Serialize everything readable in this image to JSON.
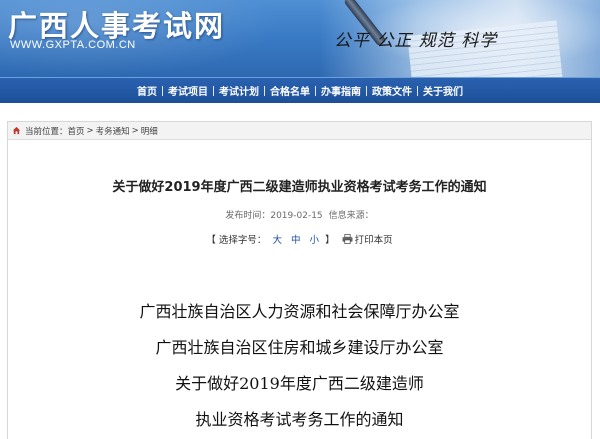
{
  "banner": {
    "site_title": "广西人事考试网",
    "site_url": "WWW.GXPTA.COM.CN",
    "slogan": "公平 公正 规范 科学"
  },
  "nav": {
    "items": [
      {
        "label": "首页"
      },
      {
        "label": "考试项目"
      },
      {
        "label": "考试计划"
      },
      {
        "label": "合格名单"
      },
      {
        "label": "办事指南"
      },
      {
        "label": "政策文件"
      },
      {
        "label": "关于我们"
      }
    ]
  },
  "breadcrumb": {
    "prefix": "当前位置：",
    "items": [
      "首页",
      "考务通知",
      "明细"
    ],
    "separator": ">"
  },
  "article": {
    "title": "关于做好2019年度广西二级建造师执业资格考试考务工作的通知",
    "publish_label": "发布时间：",
    "publish_date": "2019-02-15",
    "source_label": "信息来源：",
    "source_value": "",
    "font_size_open": "【",
    "font_size_label": "选择字号：",
    "font_sizes": [
      "大",
      "中",
      "小"
    ],
    "font_size_close": "】",
    "print_label": "打印本页",
    "body_lines": [
      "广西壮族自治区人力资源和社会保障厅办公室",
      "广西壮族自治区住房和城乡建设厅办公室",
      "关于做好2019年度广西二级建造师",
      "执业资格考试考务工作的通知"
    ]
  },
  "colors": {
    "banner_blue": "#3b7cc6",
    "nav_blue": "#1d4f98",
    "link_blue": "#1f4fa0"
  }
}
